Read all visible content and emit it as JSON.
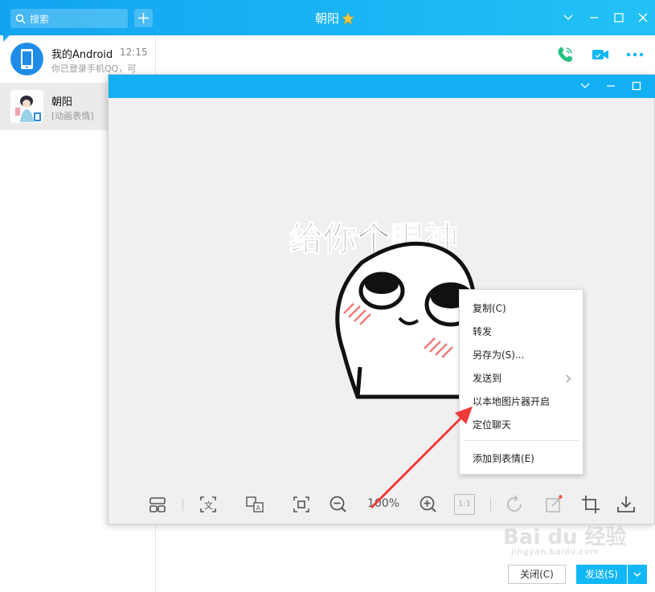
{
  "main": {
    "search_placeholder": "搜索",
    "title": "朝阳"
  },
  "conversations": [
    {
      "name": "我的Android",
      "time": "12:15",
      "subtitle": "你已登录手机QQ，可"
    },
    {
      "name": "朝阳",
      "time": "",
      "subtitle": "[动画表情]"
    }
  ],
  "viewer": {
    "sticker_caption": "给你个眼神",
    "zoom": "100%",
    "actual_size_label": "1:1"
  },
  "context_menu": {
    "items": [
      "复制(C)",
      "转发",
      "另存为(S)...",
      "发送到",
      "以本地图片器开启",
      "定位聊天",
      "添加到表情(E)"
    ]
  },
  "footer": {
    "close_label": "关闭(C)",
    "send_label": "发送(S)"
  },
  "watermark": {
    "text": "Bai du 经验",
    "sub": "jingyan.baidu.com"
  },
  "colors": {
    "titlebar": "#13a4f0",
    "viewer_bar": "#12b0f2",
    "send_button": "#12b7f5",
    "arrow": "#f03a3a",
    "call_icon": "#26c281",
    "video_icon": "#12b7f5"
  }
}
